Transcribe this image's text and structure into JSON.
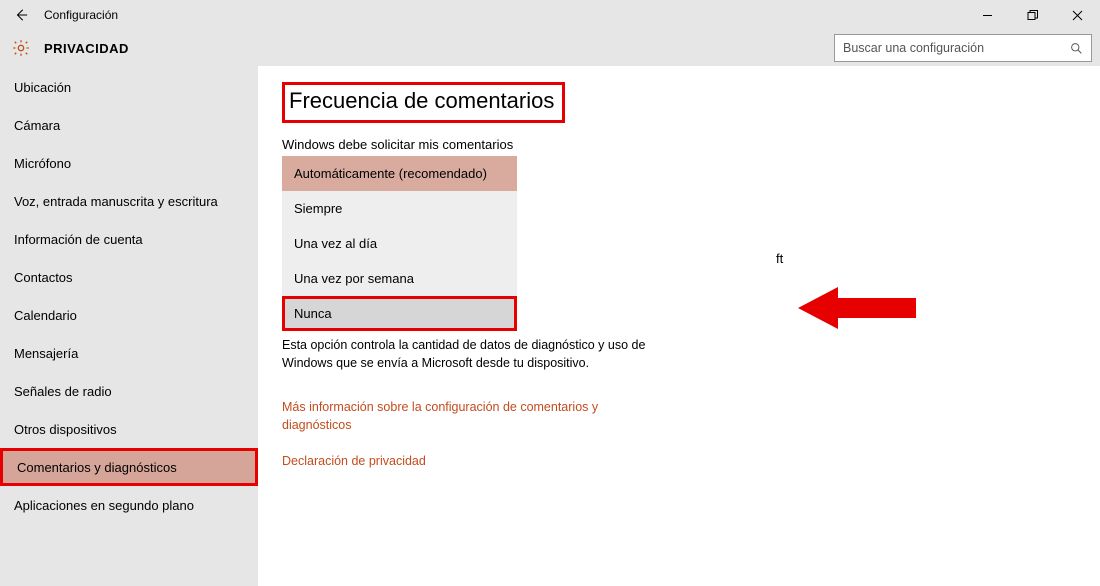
{
  "titlebar": {
    "title": "Configuración"
  },
  "header": {
    "category": "PRIVACIDAD",
    "search_placeholder": "Buscar una configuración"
  },
  "sidebar": {
    "items": [
      "Ubicación",
      "Cámara",
      "Micrófono",
      "Voz, entrada manuscrita y escritura",
      "Información de cuenta",
      "Contactos",
      "Calendario",
      "Mensajería",
      "Señales de radio",
      "Otros dispositivos",
      "Comentarios y diagnósticos",
      "Aplicaciones en segundo plano"
    ],
    "selected_index": 10
  },
  "main": {
    "section_title": "Frecuencia de comentarios",
    "subtitle": "Windows debe solicitar mis comentarios",
    "options": [
      "Automáticamente (recomendado)",
      "Siempre",
      "Una vez al día",
      "Una vez por semana",
      "Nunca"
    ],
    "selected_option_index": 0,
    "hover_option_index": 4,
    "stray_text": "ft",
    "description": "Esta opción controla la cantidad de datos de diagnóstico y uso de Windows que se envía a Microsoft desde tu dispositivo.",
    "link1": "Más información sobre la configuración de comentarios y diagnósticos",
    "link2": "Declaración de privacidad"
  }
}
